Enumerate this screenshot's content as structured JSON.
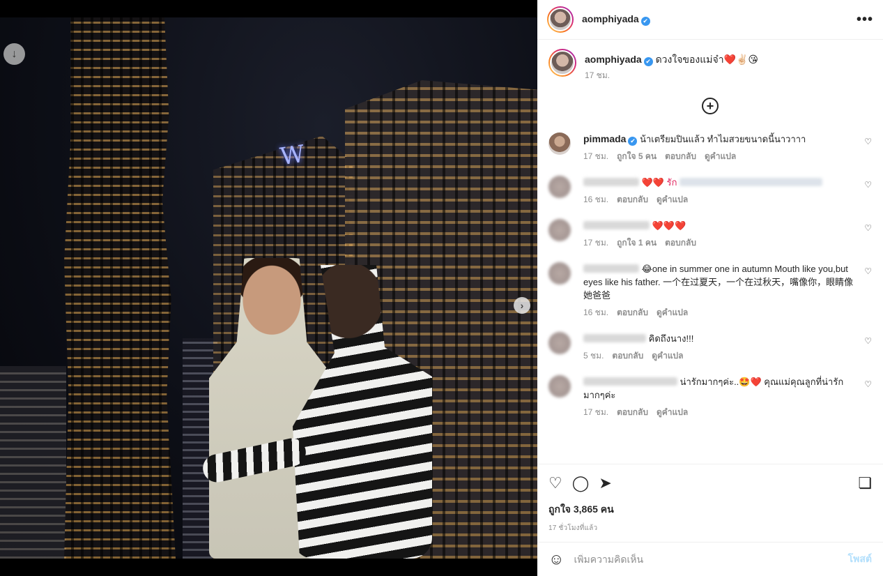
{
  "post": {
    "author": "aomphiyada",
    "caption": "ดวงใจของแม่จ๋า❤️✌🏻😘",
    "caption_time": "17 ชม.",
    "likes": "ถูกใจ 3,865 คน",
    "time_ago": "17 ชั่วโมงที่แล้ว",
    "carousel_count": 3,
    "carousel_active": 1
  },
  "icons": {
    "verified": "✔",
    "more": "•••",
    "download": "↓",
    "next": "›",
    "load_more": "+",
    "heart": "♡",
    "comment": "◯",
    "share": "➤",
    "bookmark": "❏",
    "emoji": "☺"
  },
  "comments": [
    {
      "user": "pimmada",
      "verified": true,
      "text": "น้าเตรียมปินแล้ว ทำไมสวยขนาดนี้นาวาาา",
      "time": "17 ชม.",
      "likes": "ถูกใจ 5 คน",
      "reply": "ตอบกลับ",
      "translate": "ดูคำแปล"
    },
    {
      "user": "",
      "text": "❤️❤️ รัก",
      "time": "16 ชม.",
      "reply": "ตอบกลับ",
      "translate": "ดูคำแปล"
    },
    {
      "user": "",
      "text": "❤️❤️❤️",
      "time": "17 ชม.",
      "likes": "ถูกใจ 1 คน",
      "reply": "ตอบกลับ"
    },
    {
      "user": "",
      "text": "😂one in summer one in autumn Mouth like you,but eyes like his father. 一个在过夏天，一个在过秋天，嘴像你，眼睛像她爸爸",
      "time": "16 ชม.",
      "reply": "ตอบกลับ",
      "translate": "ดูคำแปล"
    },
    {
      "user": "",
      "text": "คิดถึงนาง!!!",
      "time": "5 ชม.",
      "reply": "ตอบกลับ",
      "translate": "ดูคำแปล"
    },
    {
      "user": "",
      "text": "น่ารักมากๆค่ะ..🤩❤️ คุณแม่คุณลูกที่น่ารักมากๆค่ะ",
      "time": "17 ชม.",
      "reply": "ตอบกลับ",
      "translate": "ดูคำแปล"
    }
  ],
  "composer": {
    "placeholder": "เพิ่มความคิดเห็น",
    "post_label": "โพสต์"
  }
}
